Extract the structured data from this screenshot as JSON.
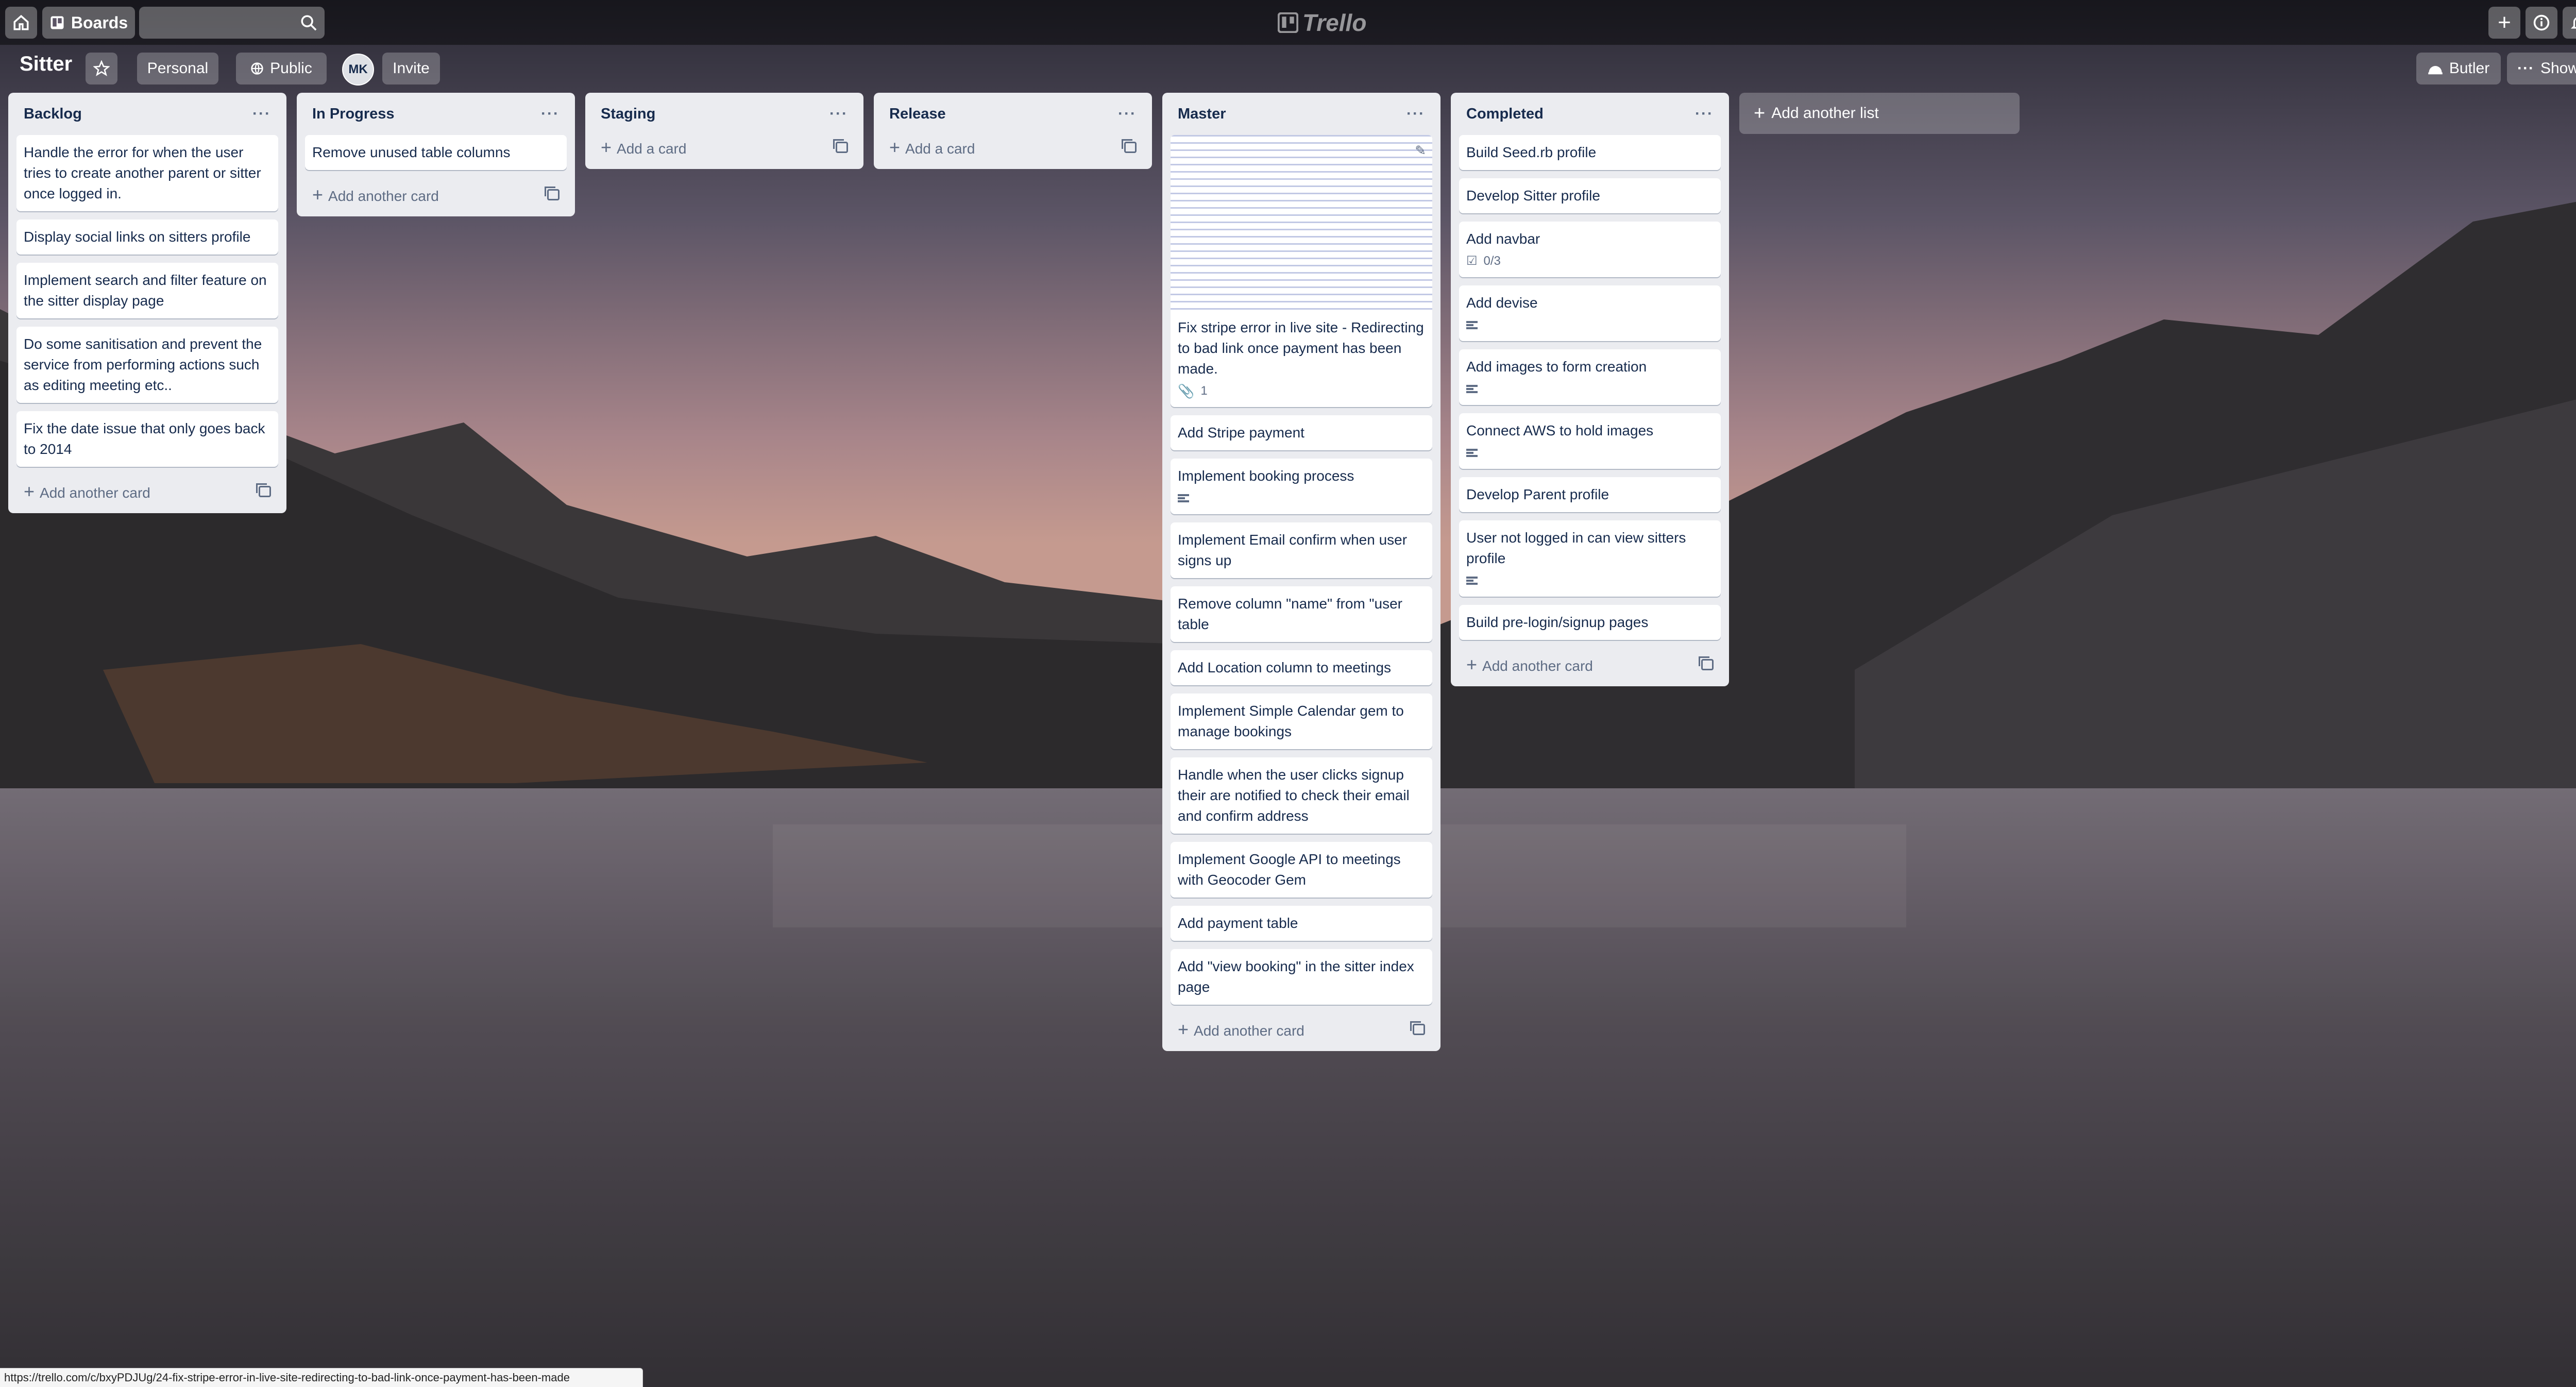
{
  "header": {
    "boards_label": "Boards",
    "logo_text": "Trello",
    "add_icon": "plus-icon",
    "info_icon": "info-icon",
    "bell_icon": "bell-icon"
  },
  "board": {
    "title": "Sitter",
    "personal_label": "Personal",
    "public_label": "Public",
    "member_initials": "MK",
    "invite_label": "Invite",
    "butler_label": "Butler",
    "show_menu_label": "Show Menu"
  },
  "lists": [
    {
      "title": "Backlog",
      "cards": [
        {
          "title": "Handle the error for when the user tries to create another parent or sitter once logged in."
        },
        {
          "title": "Display social links on sitters profile"
        },
        {
          "title": "Implement search and filter feature on the sitter display page"
        },
        {
          "title": "Do some sanitisation and prevent the service from performing actions such as editing meeting etc.."
        },
        {
          "title": "Fix the date issue that only goes back to 2014"
        }
      ],
      "add_label": "Add another card"
    },
    {
      "title": "In Progress",
      "cards": [
        {
          "title": "Remove unused table columns"
        }
      ],
      "add_label": "Add another card"
    },
    {
      "title": "Staging",
      "cards": [],
      "add_label": "Add a card"
    },
    {
      "title": "Release",
      "cards": [],
      "add_label": "Add a card"
    },
    {
      "title": "Master",
      "cards": [
        {
          "title": "Fix stripe error in live site - Redirecting to bad link once payment has been made.",
          "attachments": "1",
          "cover": true
        },
        {
          "title": "Add Stripe payment"
        },
        {
          "title": "Implement booking process",
          "description": true
        },
        {
          "title": "Implement Email confirm when user signs up"
        },
        {
          "title": "Remove column \"name\" from \"user table"
        },
        {
          "title": "Add Location column to meetings"
        },
        {
          "title": "Implement Simple Calendar gem to manage bookings"
        },
        {
          "title": "Handle when the user clicks signup their are notified to check their email and confirm address"
        },
        {
          "title": "Implement Google API to meetings with Geocoder Gem"
        },
        {
          "title": "Add payment table"
        },
        {
          "title": "Add \"view booking\" in the sitter index page"
        }
      ],
      "add_label": "Add another card"
    },
    {
      "title": "Completed",
      "cards": [
        {
          "title": "Build Seed.rb profile"
        },
        {
          "title": "Develop Sitter profile"
        },
        {
          "title": "Add navbar",
          "checklist": "0/3"
        },
        {
          "title": "Add devise",
          "description": true
        },
        {
          "title": "Add images to form creation",
          "description": true
        },
        {
          "title": "Connect AWS to hold images",
          "description": true
        },
        {
          "title": "Develop Parent profile"
        },
        {
          "title": "User not logged in can view sitters profile",
          "description": true
        },
        {
          "title": "Build pre-login/signup pages"
        }
      ],
      "add_label": "Add another card"
    }
  ],
  "add_list_label": "Add another list",
  "status_url": "https://trello.com/c/bxyPDJUg/24-fix-stripe-error-in-live-site-redirecting-to-bad-link-once-payment-has-been-made"
}
